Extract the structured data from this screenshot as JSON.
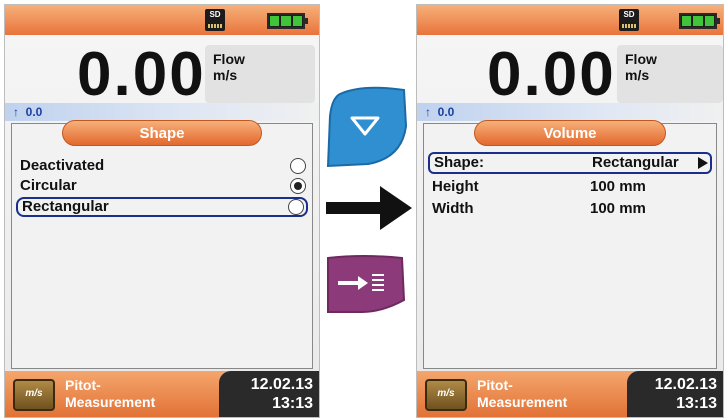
{
  "left": {
    "sd_label": "SD",
    "value": "0.00",
    "unit_top": "Flow",
    "unit_bottom": "m/s",
    "sub_value": "0.0",
    "panel_title": "Shape",
    "options": [
      {
        "label": "Deactivated",
        "checked": false
      },
      {
        "label": "Circular",
        "checked": true
      },
      {
        "label": "Rectangular",
        "checked": false
      }
    ],
    "selected_option": 2,
    "program_line1": "Pitot-",
    "program_line2": "Measurement",
    "program_icon": "m/s",
    "date": "12.02.13",
    "time": "13:13"
  },
  "right": {
    "sd_label": "SD",
    "value": "0.00",
    "unit_top": "Flow",
    "unit_bottom": "m/s",
    "sub_value": "0.0",
    "panel_title": "Volume",
    "rows": [
      {
        "key": "Shape:",
        "value": "Rectangular"
      },
      {
        "key": "Height",
        "value": "100 mm"
      },
      {
        "key": "Width",
        "value": "100 mm"
      }
    ],
    "program_line1": "Pitot-",
    "program_line2": "Measurement",
    "program_icon": "m/s",
    "date": "12.02.13",
    "time": "13:13"
  },
  "controls": {
    "nav_down_icon": "triangle-down-outline-icon",
    "confirm_icon": "arrow-to-list-icon",
    "transition_icon": "arrow-right-icon",
    "nav_color": "#2f8fd0",
    "confirm_color": "#8c3a7a"
  },
  "colors": {
    "accent_orange": "#e8743b",
    "selection_blue": "#1a2f8c",
    "battery_green": "#3fc43a"
  }
}
